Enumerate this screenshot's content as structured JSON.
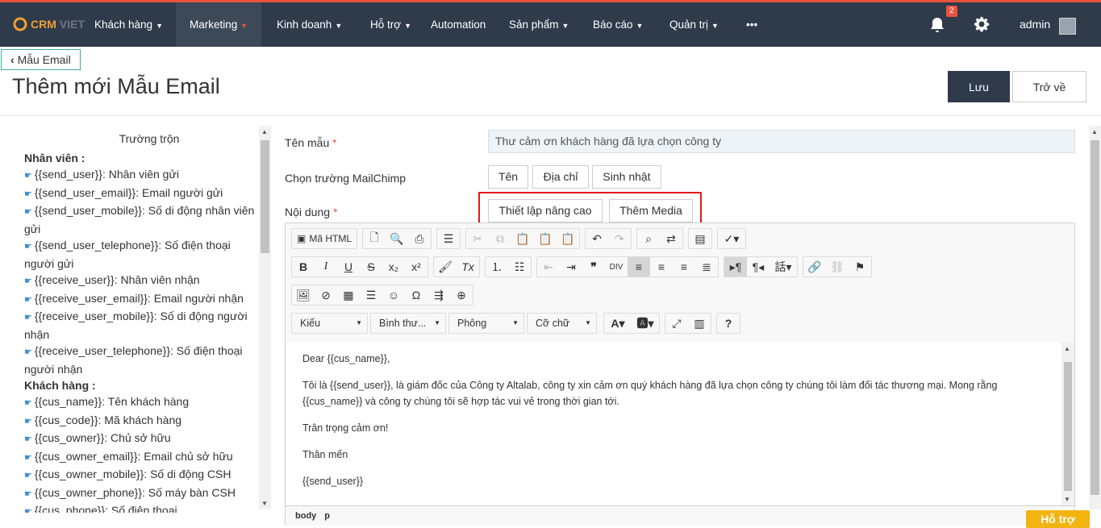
{
  "nav": {
    "logo_text_1": "CRM",
    "logo_text_2": "VIET",
    "items": [
      {
        "label": "Khách hàng"
      },
      {
        "label": "Marketing"
      },
      {
        "label": "Kinh doanh"
      },
      {
        "label": "Hỗ trợ"
      },
      {
        "label": "Automation"
      },
      {
        "label": "Sản phẩm"
      },
      {
        "label": "Báo cáo"
      },
      {
        "label": "Quản trị"
      },
      {
        "label": "•••"
      }
    ],
    "notification_count": "2",
    "user": "admin"
  },
  "header": {
    "back_label": "Mẫu Email",
    "title": "Thêm mới Mẫu Email",
    "save_label": "Lưu",
    "return_label": "Trở về"
  },
  "merge": {
    "title": "Trường trộn",
    "groups": [
      {
        "title": "Nhân viên :",
        "fields": [
          "{{send_user}}: Nhân viên gửi",
          "{{send_user_email}}: Email người gửi",
          "{{send_user_mobile}}: Số di động nhân viên gửi",
          "{{send_user_telephone}}: Số điện thoại người gửi",
          "{{receive_user}}: Nhân viên nhận",
          "{{receive_user_email}}: Email người nhận",
          "{{receive_user_mobile}}: Số di động người nhận",
          "{{receive_user_telephone}}: Số điện thoại người nhận"
        ]
      },
      {
        "title": "Khách hàng :",
        "fields": [
          "{{cus_name}}: Tên khách hàng",
          "{{cus_code}}: Mã khách hàng",
          "{{cus_owner}}: Chủ sở hữu",
          "{{cus_owner_email}}: Email chủ sở hữu",
          "{{cus_owner_mobile}}: Số di động CSH",
          "{{cus_owner_phone}}: Số máy bàn CSH",
          "{{cus_phone}}: Số điện thoại"
        ]
      }
    ]
  },
  "form": {
    "name_label": "Tên mẫu",
    "required_mark": "*",
    "name_value": "Thư cảm ơn khách hàng đã lựa chọn công ty",
    "mailchimp_label": "Chọn trường MailChimp",
    "mailchimp_buttons": [
      "Tên",
      "Địa chỉ",
      "Sinh nhật"
    ],
    "content_label": "Nội dung",
    "advanced_label": "Thiết lập nâng cao",
    "media_label": "Thêm Media"
  },
  "editor": {
    "source_label": "Mã HTML",
    "combos": [
      "Kiểu",
      "Bình thư...",
      "Phông",
      "Cỡ chữ"
    ],
    "paragraphs": [
      "Dear {{cus_name}},",
      "Tôi là {{send_user}}, là giám đốc của Công ty Altalab, công ty xin cảm ơn quý khách hàng đã lựa chọn công ty chúng tôi làm đối tác thương mại. Mong rằng {{cus_name}} và công ty chúng tôi sẽ hợp tác vui vẻ trong thời gian tới.",
      "Trân trọng cảm ơn!",
      "Thân mến",
      "{{send_user}}"
    ],
    "path": [
      "body",
      "p"
    ]
  },
  "help_label": "Hỗ trợ",
  "colors": {
    "topbar": "#2f3a4b",
    "accent": "#e8533f",
    "help": "#f3b411",
    "highlight": "#e0191b"
  }
}
